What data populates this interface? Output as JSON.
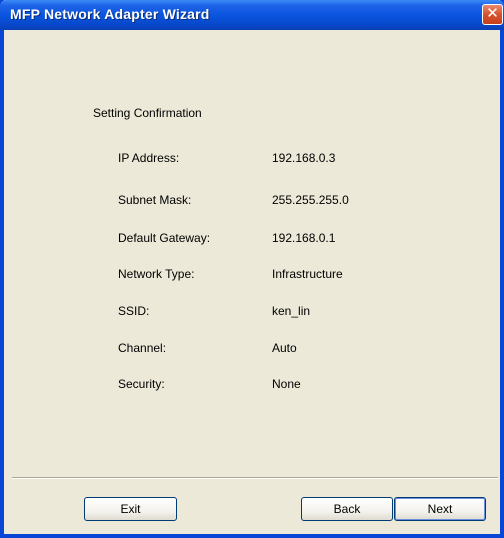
{
  "window": {
    "title": "MFP Network Adapter Wizard",
    "close_label": "✕"
  },
  "section": {
    "title": "Setting Confirmation"
  },
  "settings": [
    {
      "label": "IP Address:",
      "value": "192.168.0.3"
    },
    {
      "label": "Subnet Mask:",
      "value": "255.255.255.0"
    },
    {
      "label": "Default Gateway:",
      "value": "192.168.0.1"
    },
    {
      "label": "Network Type:",
      "value": "Infrastructure"
    },
    {
      "label": "SSID:",
      "value": "ken_lin"
    },
    {
      "label": "Channel:",
      "value": "Auto"
    },
    {
      "label": "Security:",
      "value": "None"
    }
  ],
  "buttons": {
    "exit": "Exit",
    "back": "Back",
    "next": "Next"
  },
  "colors": {
    "titlebar": "#0a55e0",
    "dialog_bg": "#ece9d8",
    "close_button": "#d5522d"
  }
}
